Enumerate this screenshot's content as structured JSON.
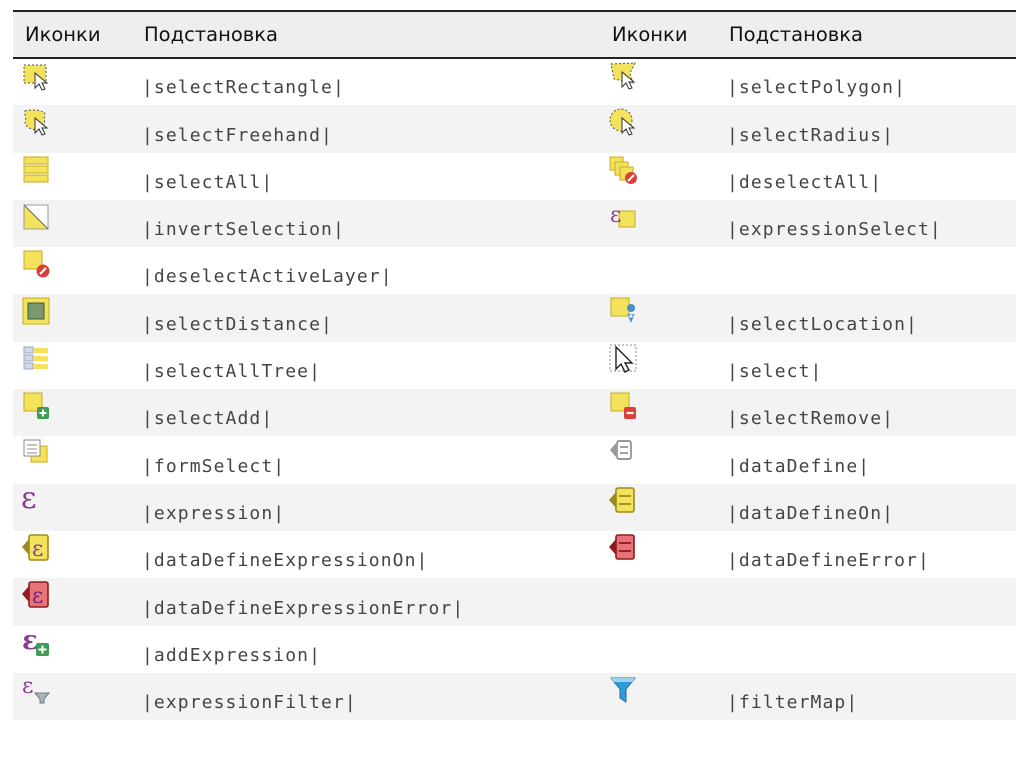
{
  "header": {
    "icons": "Иконки",
    "substitution": "Подстановка"
  },
  "rows": [
    {
      "left": {
        "icon": "select-rectangle-icon",
        "sub": "|selectRectangle|"
      },
      "right": {
        "icon": "select-polygon-icon",
        "sub": "|selectPolygon|"
      }
    },
    {
      "left": {
        "icon": "select-freehand-icon",
        "sub": "|selectFreehand|"
      },
      "right": {
        "icon": "select-radius-icon",
        "sub": "|selectRadius|"
      }
    },
    {
      "left": {
        "icon": "select-all-icon",
        "sub": "|selectAll|"
      },
      "right": {
        "icon": "deselect-all-icon",
        "sub": "|deselectAll|"
      }
    },
    {
      "left": {
        "icon": "invert-selection-icon",
        "sub": "|invertSelection|"
      },
      "right": {
        "icon": "expression-select-icon",
        "sub": "|expressionSelect|"
      }
    },
    {
      "left": {
        "icon": "deselect-active-layer-icon",
        "sub": "|deselectActiveLayer|"
      },
      "right": {
        "icon": "",
        "sub": ""
      }
    },
    {
      "left": {
        "icon": "select-distance-icon",
        "sub": "|selectDistance|"
      },
      "right": {
        "icon": "select-location-icon",
        "sub": "|selectLocation|"
      }
    },
    {
      "left": {
        "icon": "select-all-tree-icon",
        "sub": "|selectAllTree|"
      },
      "right": {
        "icon": "select-cursor-icon",
        "sub": "|select|"
      }
    },
    {
      "left": {
        "icon": "select-add-icon",
        "sub": "|selectAdd|"
      },
      "right": {
        "icon": "select-remove-icon",
        "sub": "|selectRemove|"
      }
    },
    {
      "left": {
        "icon": "form-select-icon",
        "sub": "|formSelect|"
      },
      "right": {
        "icon": "data-define-icon",
        "sub": "|dataDefine|"
      }
    },
    {
      "left": {
        "icon": "expression-icon",
        "sub": "|expression|"
      },
      "right": {
        "icon": "data-define-on-icon",
        "sub": "|dataDefineOn|"
      }
    },
    {
      "left": {
        "icon": "data-define-expression-on-icon",
        "sub": "|dataDefineExpressionOn|"
      },
      "right": {
        "icon": "data-define-error-icon",
        "sub": "|dataDefineError|"
      }
    },
    {
      "left": {
        "icon": "data-define-expression-error-icon",
        "sub": "|dataDefineExpressionError|"
      },
      "right": {
        "icon": "",
        "sub": ""
      }
    },
    {
      "left": {
        "icon": "add-expression-icon",
        "sub": "|addExpression|"
      },
      "right": {
        "icon": "",
        "sub": ""
      }
    },
    {
      "left": {
        "icon": "expression-filter-icon",
        "sub": "|expressionFilter|"
      },
      "right": {
        "icon": "filter-map-icon",
        "sub": "|filterMap|"
      }
    }
  ],
  "colors": {
    "icon_yellow": "#f3e25c",
    "icon_yellow_border": "#c9ab1e",
    "epsilon_purple": "#8a3a92",
    "badge_red": "#d9403a",
    "badge_green": "#3f9b55",
    "filter_blue": "#2f9bd4",
    "header_bg": "#eeeeee",
    "stripe_bg": "#f3f3f3"
  }
}
